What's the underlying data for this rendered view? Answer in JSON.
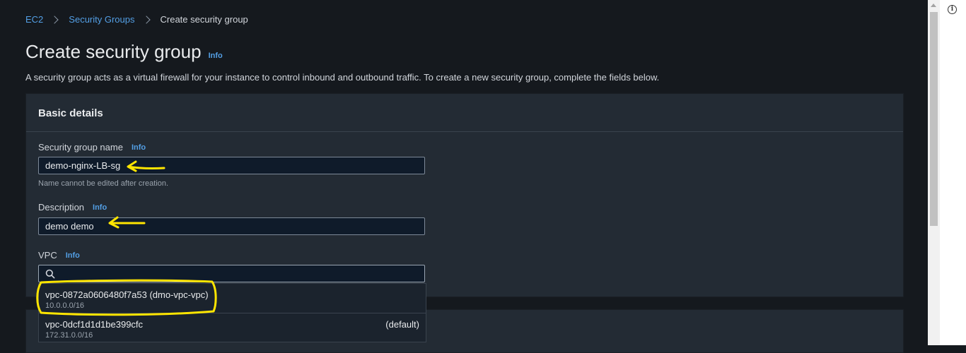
{
  "breadcrumb": {
    "root": "EC2",
    "parent": "Security Groups",
    "current": "Create security group"
  },
  "page": {
    "title": "Create security group",
    "info": "Info",
    "description": "A security group acts as a virtual firewall for your instance to control inbound and outbound traffic. To create a new security group, complete the fields below."
  },
  "basic_details": {
    "heading": "Basic details",
    "name": {
      "label": "Security group name",
      "info": "Info",
      "value": "demo-nginx-LB-sg",
      "hint": "Name cannot be edited after creation."
    },
    "description": {
      "label": "Description",
      "info": "Info",
      "value": "demo demo"
    },
    "vpc": {
      "label": "VPC",
      "info": "Info",
      "search_value": "",
      "options": [
        {
          "id": "vpc-0872a0606480f7a53 (dmo-vpc-vpc)",
          "cidr": "10.0.0.0/16",
          "tag": ""
        },
        {
          "id": "vpc-0dcf1d1d1be399cfc",
          "cidr": "172.31.0.0/16",
          "tag": "(default)"
        }
      ]
    }
  },
  "colors": {
    "annotation": "#ffe500",
    "link": "#539fe5",
    "background": "#15191e",
    "panel": "#232b34"
  },
  "icons": {
    "search": "search-icon",
    "info": "info-circle-icon"
  }
}
